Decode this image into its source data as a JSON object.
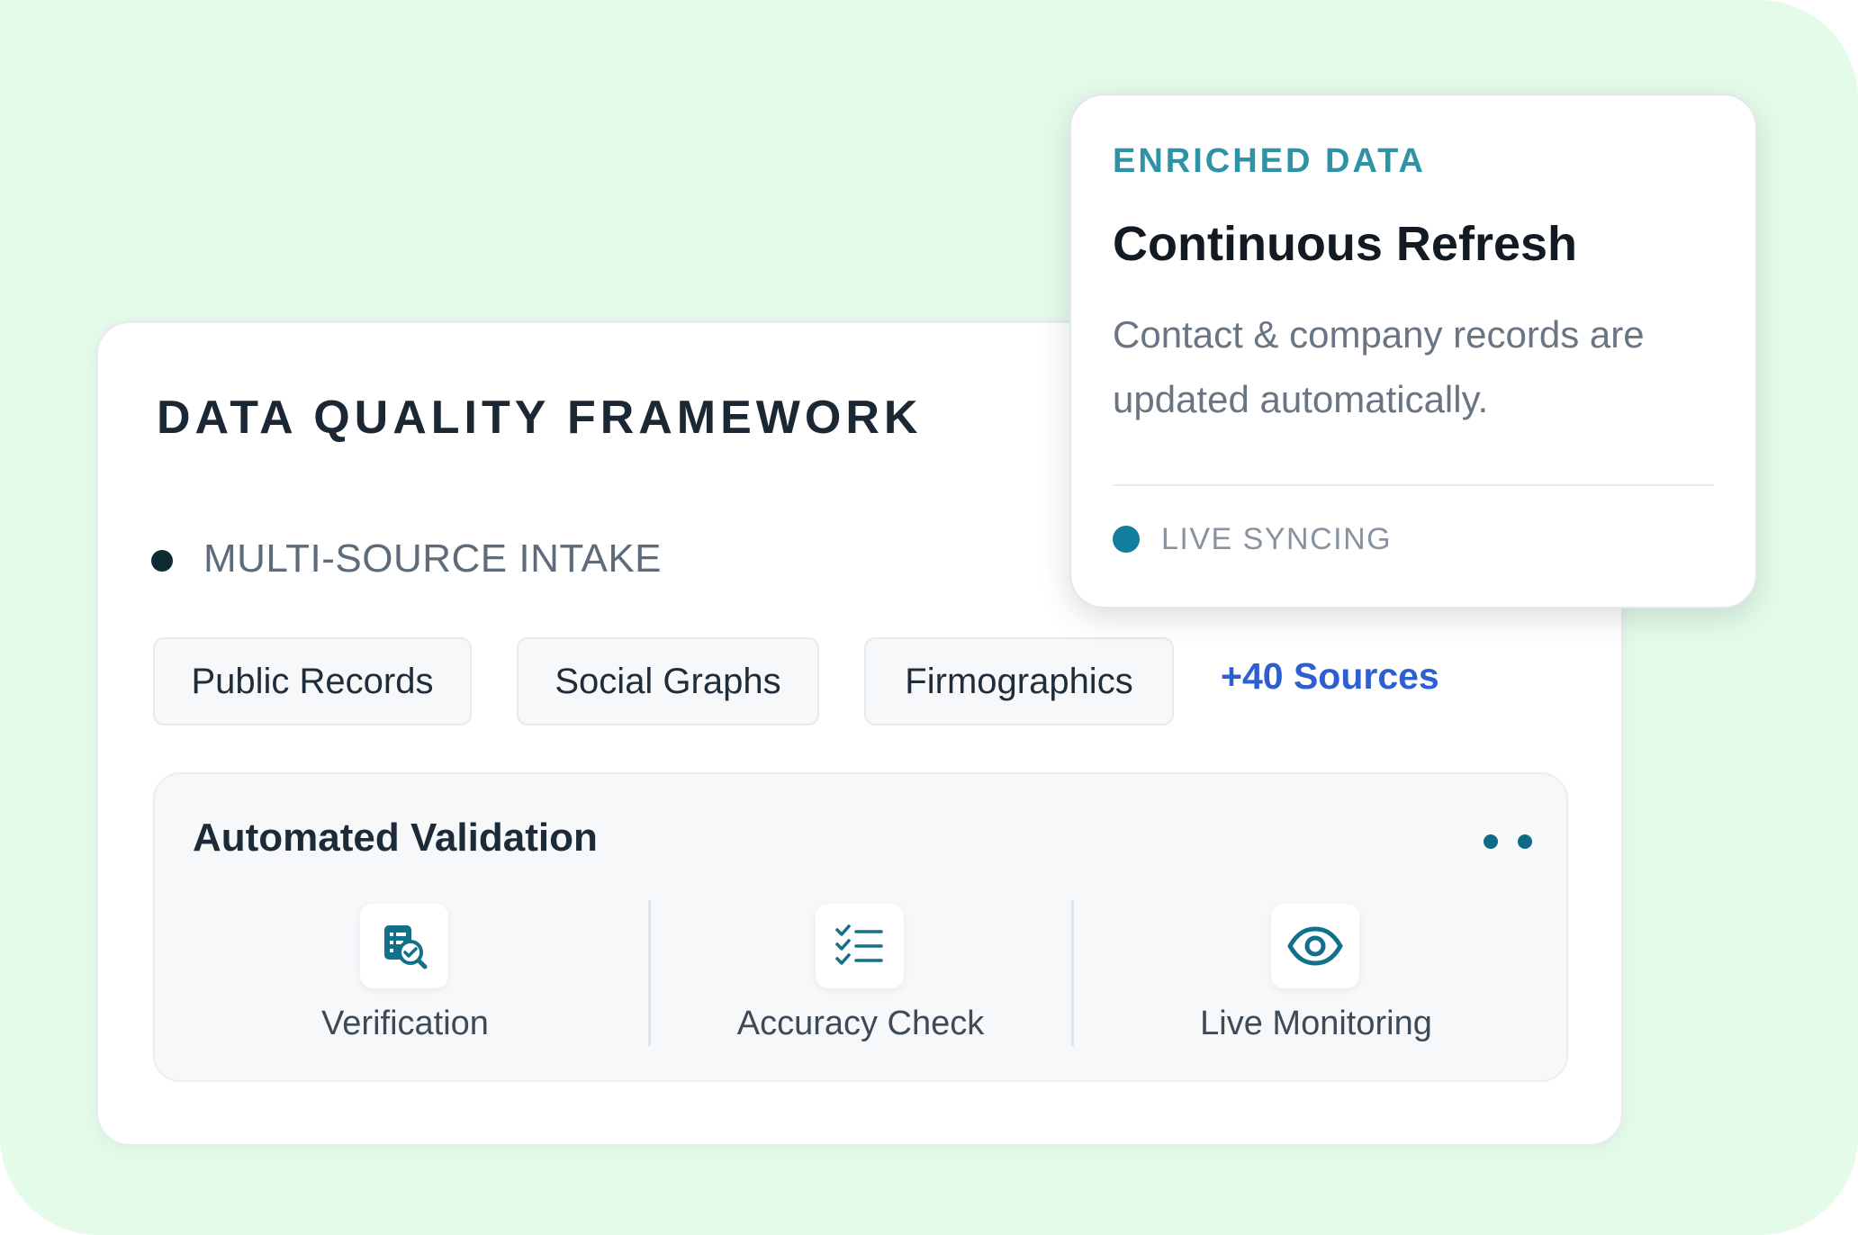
{
  "colors": {
    "background": "#e5fbea",
    "accent_teal": "#117e9e",
    "eyebrow_teal": "#2f93a6",
    "link_blue": "#2d5fd0",
    "title_dark": "#1b2733"
  },
  "framework": {
    "title": "DATA QUALITY FRAMEWORK",
    "intake": {
      "bullet_icon": "dot-icon",
      "label": "MULTI-SOURCE INTAKE"
    },
    "sources": [
      {
        "label": "Public Records"
      },
      {
        "label": "Social Graphs"
      },
      {
        "label": "Firmographics"
      }
    ],
    "more_sources_label": "+40 Sources"
  },
  "validation": {
    "title": "Automated Validation",
    "menu_icon": "more-dots-icon",
    "checks": [
      {
        "label": "Verification",
        "icon": "verification-icon"
      },
      {
        "label": "Accuracy Check",
        "icon": "checklist-icon"
      },
      {
        "label": "Live Monitoring",
        "icon": "eye-icon"
      }
    ]
  },
  "enriched": {
    "eyebrow": "ENRICHED DATA",
    "title": "Continuous Refresh",
    "description": "Contact & company records are updated automatically.",
    "status": {
      "label": "LIVE SYNCING",
      "icon": "status-dot-icon"
    }
  }
}
